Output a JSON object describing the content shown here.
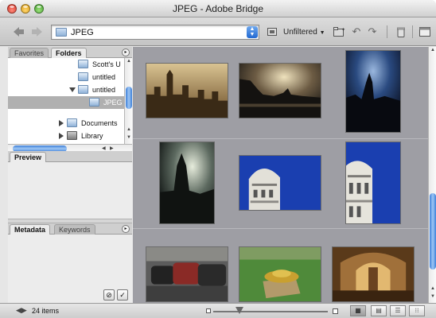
{
  "window": {
    "title": "JPEG - Adobe Bridge"
  },
  "toolbar": {
    "path": "JPEG",
    "filter_label": "Unfiltered"
  },
  "panels": {
    "top_tabs": [
      "Favorites",
      "Folders"
    ],
    "folder_tree": [
      {
        "label": "Scott's U",
        "indent": 2,
        "expander": "none",
        "selected": false
      },
      {
        "label": "untitled",
        "indent": 2,
        "expander": "none",
        "selected": false
      },
      {
        "label": "untitled",
        "indent": 2,
        "expander": "down",
        "selected": false
      },
      {
        "label": "JPEG",
        "indent": 3,
        "expander": "none",
        "selected": true
      },
      {
        "label": "Documents",
        "indent": 1,
        "expander": "right",
        "selected": false
      },
      {
        "label": "Library",
        "indent": 1,
        "expander": "right",
        "selected": false
      }
    ],
    "preview_tab": "Preview",
    "bottom_tabs": [
      "Metadata",
      "Keywords"
    ]
  },
  "thumbnails": [
    {
      "name": "london-skyline-sepia",
      "colors": [
        "#c9b080",
        "#8a6a3a",
        "#3a2b18"
      ]
    },
    {
      "name": "thames-dusk",
      "colors": [
        "#d8c8a0",
        "#5a4a38",
        "#1c1a18"
      ]
    },
    {
      "name": "big-ben-night",
      "colors": [
        "#3f6aa8",
        "#1b2f55",
        "#0c1020"
      ]
    },
    {
      "name": "big-ben-silhouette",
      "colors": [
        "#b9c2b2",
        "#4a5650",
        "#151a18"
      ]
    },
    {
      "name": "dome-building-blue",
      "colors": [
        "#1a3fb0",
        "#e4e2da",
        "#7b7a78"
      ]
    },
    {
      "name": "dome-tower-blue",
      "colors": [
        "#1a3fb0",
        "#e8e6de",
        "#80807c"
      ]
    },
    {
      "name": "london-taxis",
      "colors": [
        "#6a6a6a",
        "#8a2a26",
        "#222"
      ]
    },
    {
      "name": "park-flowerbed",
      "colors": [
        "#4f8a3a",
        "#c9a030",
        "#2e5a24"
      ]
    },
    {
      "name": "cathedral-interior",
      "colors": [
        "#a0703a",
        "#5a3a1a",
        "#e2b870"
      ]
    }
  ],
  "status": {
    "item_count": "24 items"
  },
  "icons": {
    "back": "back-arrow-icon",
    "forward": "forward-arrow-icon",
    "folder": "folder-icon",
    "rotate_ccw": "rotate-ccw-icon",
    "rotate_cw": "rotate-cw-icon",
    "trash": "trash-icon",
    "new_folder": "new-folder-icon",
    "compact": "compact-mode-icon"
  }
}
